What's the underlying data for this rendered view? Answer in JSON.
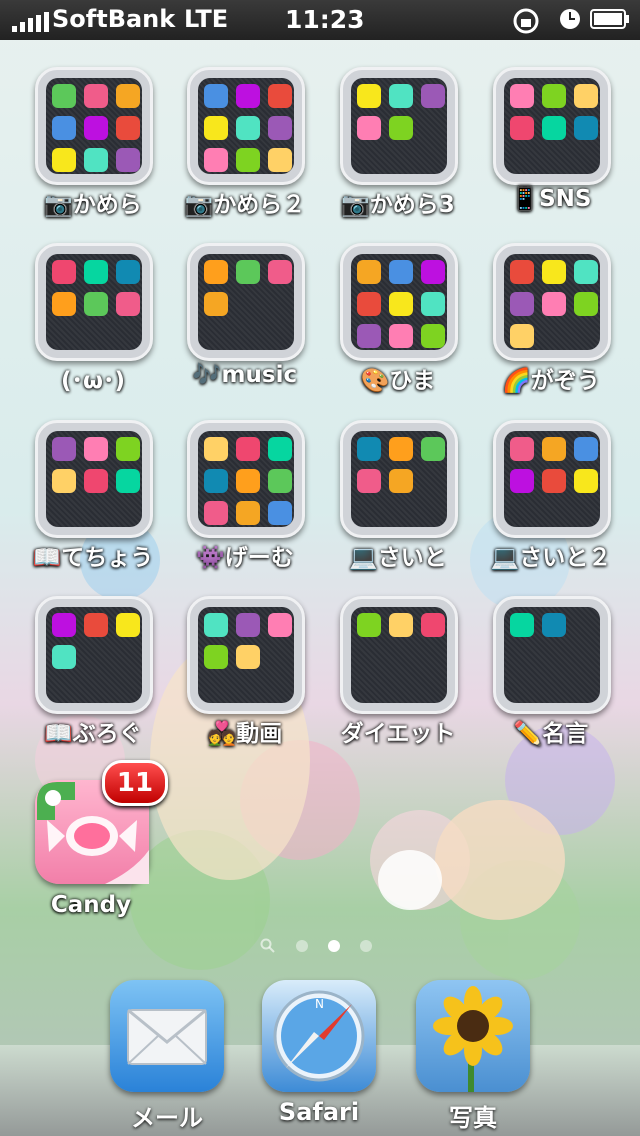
{
  "status_bar": {
    "carrier": "SoftBank",
    "network": "LTE",
    "time": "11:23"
  },
  "folders": [
    {
      "label": "📷かめら"
    },
    {
      "label": "📷かめら２"
    },
    {
      "label": "📷かめら3"
    },
    {
      "label": "📱SNS"
    },
    {
      "label": "(･ω･)"
    },
    {
      "label": "🎶music"
    },
    {
      "label": "🎨ひま"
    },
    {
      "label": "🌈がぞう"
    },
    {
      "label": "📖てちょう"
    },
    {
      "label": "👾げーむ"
    },
    {
      "label": "💻さいと"
    },
    {
      "label": "💻さいと２"
    },
    {
      "label": "📖ぶろぐ"
    },
    {
      "label": "💑動画"
    },
    {
      "label": "ダイエット"
    },
    {
      "label": "✏️名言"
    }
  ],
  "app": {
    "label": "Candy",
    "badge": "11"
  },
  "page_dots": {
    "active": 2,
    "count": 3
  },
  "dock": [
    {
      "label": "メール",
      "icon": "mail-icon"
    },
    {
      "label": "Safari",
      "icon": "compass-icon"
    },
    {
      "label": "写真",
      "icon": "sunflower-icon"
    }
  ]
}
